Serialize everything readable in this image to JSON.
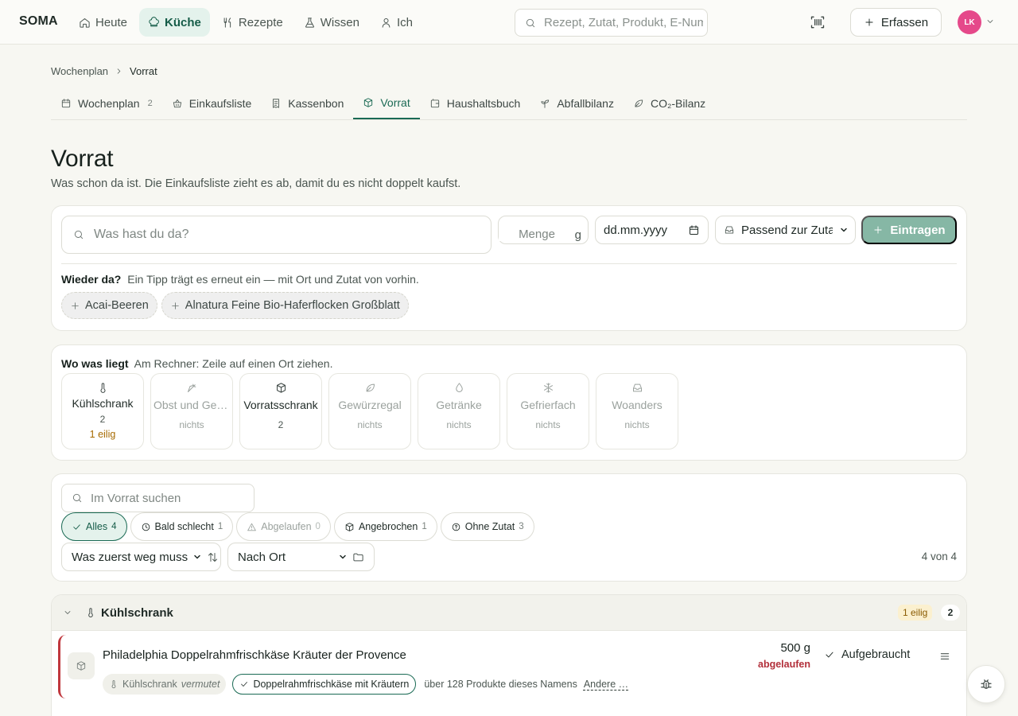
{
  "nav": {
    "brand": "SOMA",
    "items": [
      {
        "label": "Heute",
        "icon": "home-icon"
      },
      {
        "label": "Küche",
        "icon": "chef-hat-icon",
        "active": true
      },
      {
        "label": "Rezepte",
        "icon": "utensils-icon"
      },
      {
        "label": "Wissen",
        "icon": "flask-icon"
      },
      {
        "label": "Ich",
        "icon": "user-icon"
      }
    ],
    "search_placeholder": "Rezept, Zutat, Produkt, E-Nummer",
    "capture_label": "Erfassen",
    "avatar_initials": "LK"
  },
  "breadcrumb": {
    "parent": "Wochenplan",
    "current": "Vorrat"
  },
  "tabs": [
    {
      "label": "Wochenplan",
      "count": "2",
      "icon": "calendar-icon"
    },
    {
      "label": "Einkaufsliste",
      "icon": "basket-icon"
    },
    {
      "label": "Kassenbon",
      "icon": "receipt-icon"
    },
    {
      "label": "Vorrat",
      "icon": "box-icon",
      "active": true
    },
    {
      "label": "Haushaltsbuch",
      "icon": "wallet-icon"
    },
    {
      "label": "Abfallbilanz",
      "icon": "sprout-icon"
    },
    {
      "label": "CO₂-Bilanz",
      "icon": "leaf-icon"
    }
  ],
  "page": {
    "title": "Vorrat",
    "subtitle": "Was schon da ist. Die Einkaufsliste zieht es ab, damit du es nicht doppelt kaufst."
  },
  "entry": {
    "search_placeholder": "Was hast du da?",
    "qty_placeholder": "Menge",
    "unit": "g",
    "date_placeholder": "dd.mm.yyyy",
    "zutat_select": "Passend zur Zutat",
    "submit_label": "Eintragen",
    "again_title": "Wieder da?",
    "again_hint": "Ein Tipp trägt es erneut ein — mit Ort und Zutat von vorhin.",
    "suggestions": [
      "Acai-Beeren",
      "Alnatura Feine Bio-Haferflocken Großblatt"
    ]
  },
  "locations": {
    "title": "Wo was liegt",
    "hint": "Am Rechner: Zeile auf einen Ort ziehen.",
    "tiles": [
      {
        "name": "Kühlschrank",
        "count": "2",
        "urgent": "1 eilig",
        "icon": "thermometer-icon"
      },
      {
        "name": "Obst und Gemüse",
        "count": "nichts",
        "icon": "carrot-icon"
      },
      {
        "name": "Vorratsschrank",
        "count": "2",
        "icon": "box-icon"
      },
      {
        "name": "Gewürzregal",
        "count": "nichts",
        "icon": "leaf-icon"
      },
      {
        "name": "Getränke",
        "count": "nichts",
        "icon": "droplet-icon"
      },
      {
        "name": "Gefrierfach",
        "count": "nichts",
        "icon": "snowflake-icon"
      },
      {
        "name": "Woanders",
        "count": "nichts",
        "icon": "inbox-icon"
      }
    ]
  },
  "filters": {
    "search_placeholder": "Im Vorrat suchen",
    "chips": [
      {
        "label": "Alles",
        "count": "4",
        "icon": "check-icon"
      },
      {
        "label": "Bald schlecht",
        "count": "1",
        "icon": "clock-icon"
      },
      {
        "label": "Abgelaufen",
        "count": "0",
        "icon": "alert-triangle-icon"
      },
      {
        "label": "Angebrochen",
        "count": "1",
        "icon": "box-icon"
      },
      {
        "label": "Ohne Zutat",
        "count": "3",
        "icon": "help-circle-icon"
      }
    ],
    "sort": "Was zuerst weg muss",
    "group": "Nach Ort",
    "result_count": "4 von 4"
  },
  "group": {
    "name": "Kühlschrank",
    "urgent_badge": "1 eilig",
    "count": "2",
    "item": {
      "name": "Philadelphia Doppelrahmfrischkäse Kräuter der Provence",
      "qty": "500 g",
      "status": "abgelaufen",
      "action": "Aufgebraucht",
      "location": "Kühlschrank",
      "location_note": "vermutet",
      "match": "Doppelrahmfrischkäse mit Kräutern",
      "note": "über 128 Produkte dieses Namens",
      "link": "Andere …"
    }
  },
  "colors": {
    "accent": "#1a6a54",
    "accent_bg": "#e4f2ec",
    "danger": "#b22f3a",
    "warning": "#a66a00",
    "button_green": "#86b7a5",
    "avatar": "#e5498a"
  }
}
